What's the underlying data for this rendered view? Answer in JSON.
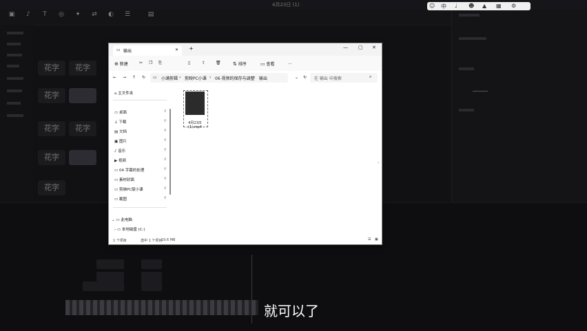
{
  "background_app": {
    "title": "4月23日 (1)",
    "subtitle_text": "就可以了",
    "tiles": [
      "花字",
      "花字",
      "花字",
      "花字",
      "花字",
      "花字",
      "花字"
    ]
  },
  "tray": {
    "icons": [
      "cat-icon",
      "keyboard-icon",
      "mic-icon",
      "emoji-icon",
      "shirt-icon",
      "grid-icon",
      "settings-icon"
    ]
  },
  "explorer": {
    "tab_title": "输出",
    "toolbar": {
      "new_label": "新建",
      "sort_label": "排序",
      "view_label": "查看",
      "more_label": "..."
    },
    "breadcrumb": [
      "小满剪辑",
      "剪映PC小课",
      "06 视频的保存与调整",
      "输出"
    ],
    "search_placeholder": "在 输出 中搜索",
    "nav": {
      "home": "主文件夹",
      "quick": [
        {
          "label": "桌面"
        },
        {
          "label": "下载"
        },
        {
          "label": "文档"
        },
        {
          "label": "图片"
        },
        {
          "label": "音乐"
        },
        {
          "label": "视频"
        },
        {
          "label": "04 字幕的处理"
        },
        {
          "label": "素材封面"
        },
        {
          "label": "剪映PC版小课"
        },
        {
          "label": "截图"
        }
      ],
      "this_pc": "此电脑",
      "drive": "本地磁盘 (C:)"
    },
    "file": {
      "name": "4月23日(1).mp4"
    },
    "status": {
      "count": "1 个项目",
      "selected": "选中 1 个项目",
      "size": "19.6 MB"
    }
  }
}
